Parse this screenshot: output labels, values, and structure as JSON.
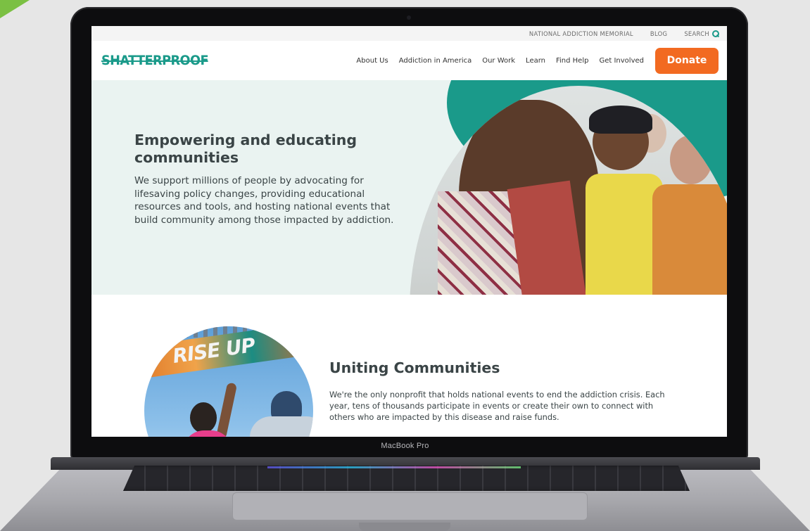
{
  "device": {
    "label": "MacBook Pro"
  },
  "colors": {
    "brand_teal": "#1a9a8a",
    "donate_orange": "#f26a21",
    "hero_background": "#eaf3f1",
    "body_text": "#3a4446"
  },
  "site": {
    "utility_bar": {
      "memorial_link": "NATIONAL ADDICTION MEMORIAL",
      "blog_link": "BLOG",
      "search_label": "SEARCH",
      "search_icon": "search-icon"
    },
    "logo": "SHATTERPROOF",
    "nav": {
      "items": [
        {
          "label": "About Us"
        },
        {
          "label": "Addiction in America"
        },
        {
          "label": "Our Work"
        },
        {
          "label": "Learn"
        },
        {
          "label": "Find Help"
        },
        {
          "label": "Get Involved"
        }
      ],
      "donate_label": "Donate"
    },
    "hero": {
      "title": "Empowering and educating communities",
      "body": "We support millions of people by advocating for lifesaving policy changes, providing educational resources and tools, and hosting national events that build community among those impacted by addiction."
    },
    "section": {
      "photo_banner_text": "RISE UP",
      "title": "Uniting Communities",
      "body": "We're the only nonprofit that holds national events to end the addiction crisis. Each year, tens of thousands participate in events or create their own to connect with others who are impacted by this disease and raise funds."
    }
  }
}
